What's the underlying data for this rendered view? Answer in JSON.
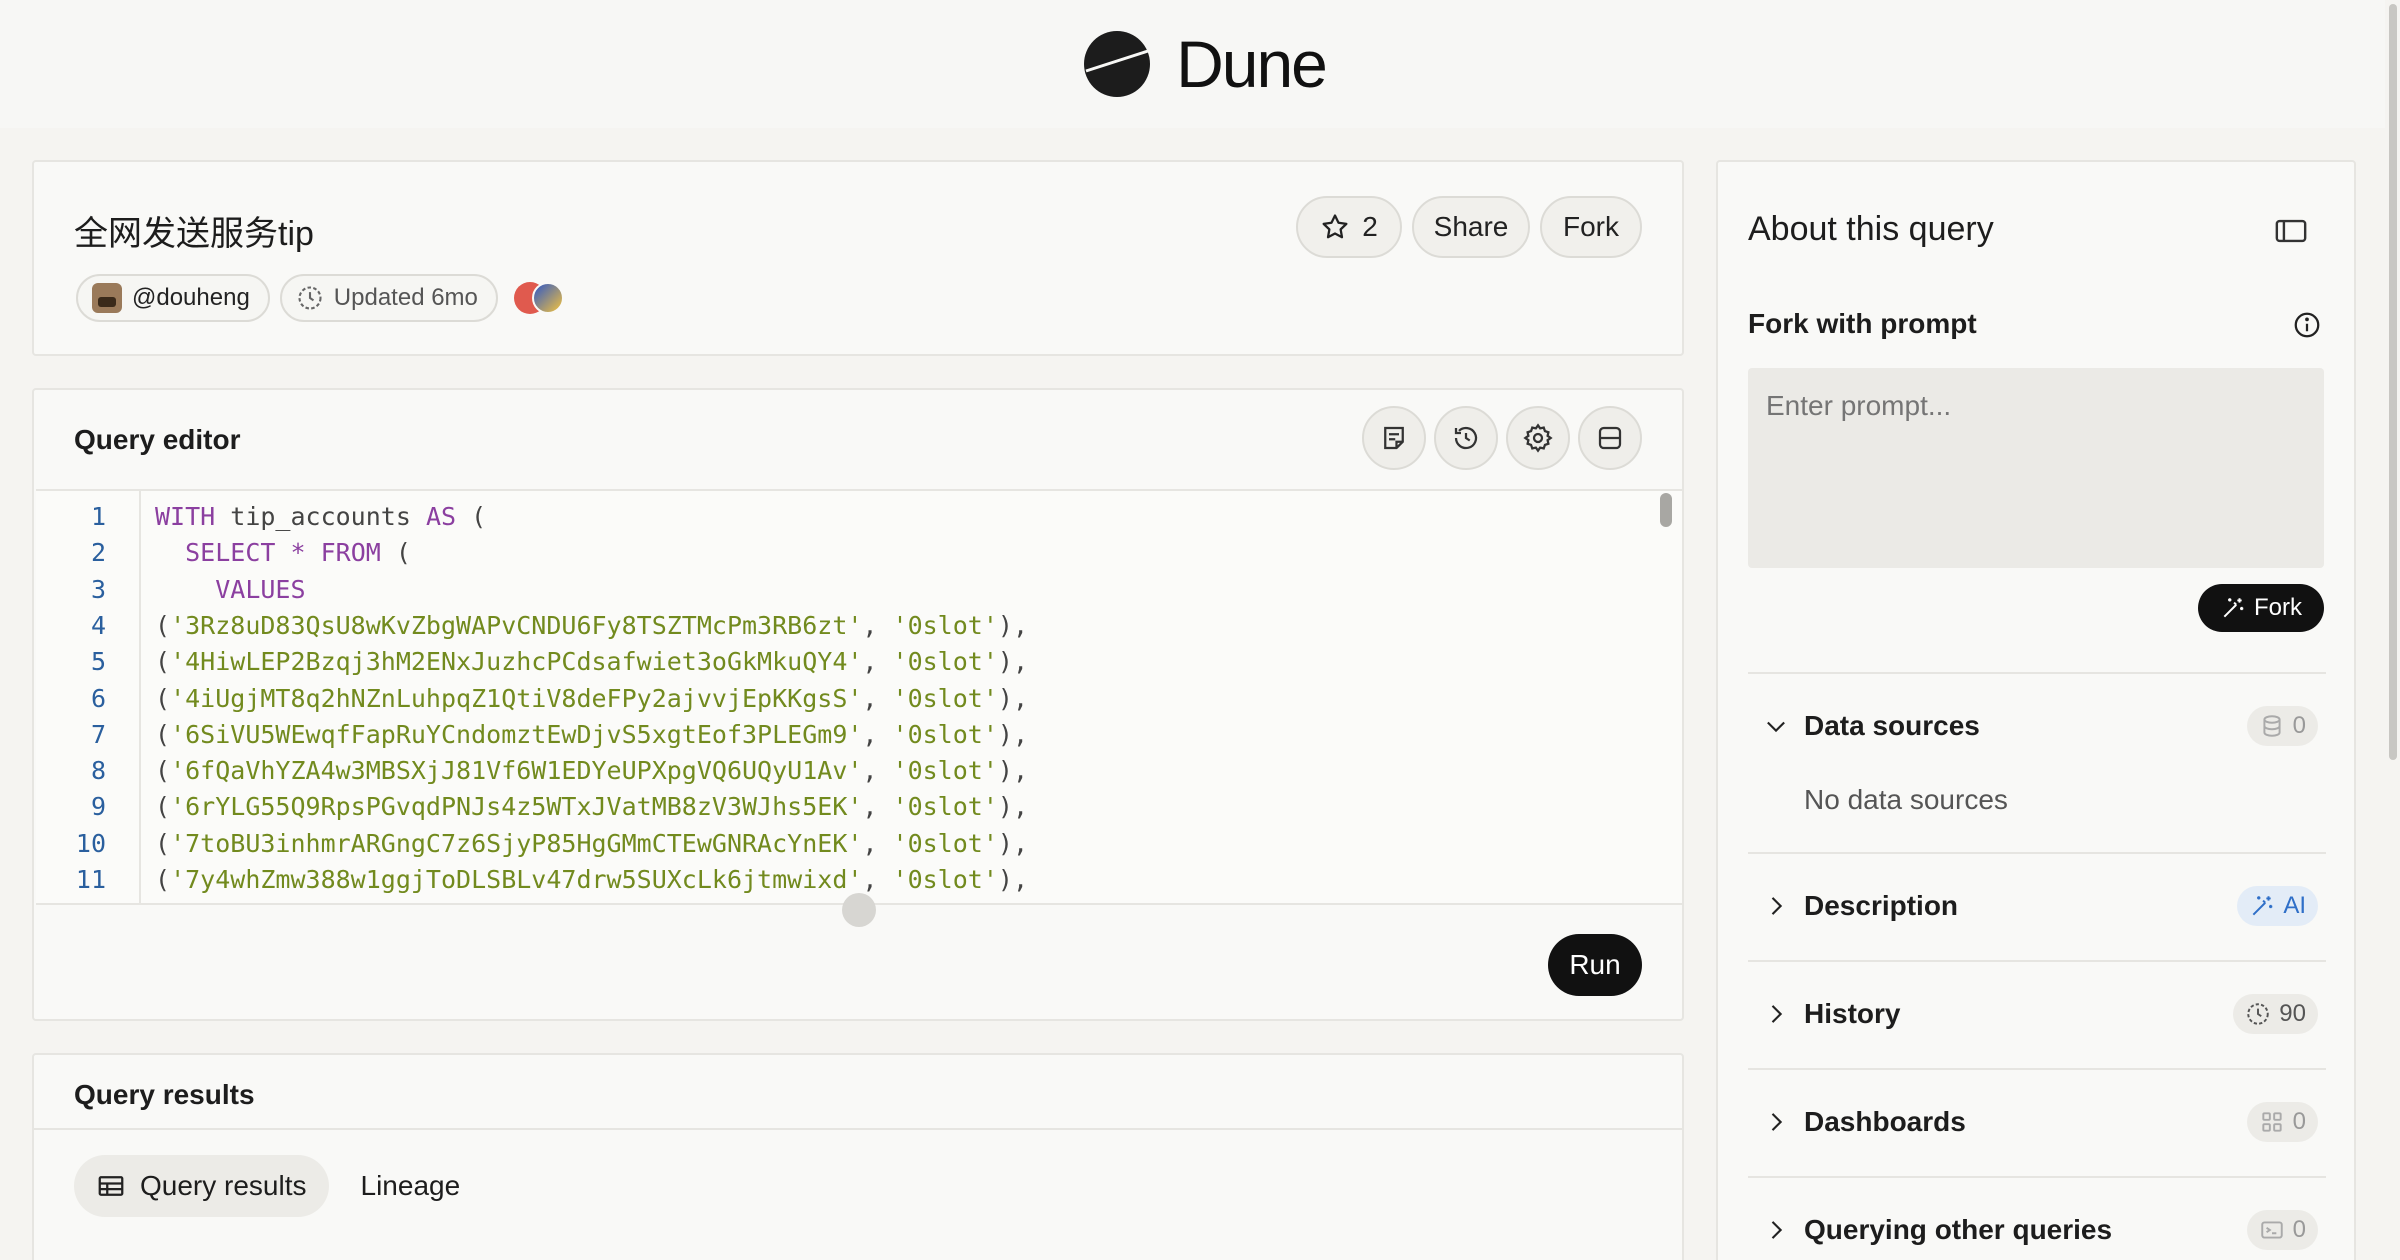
{
  "brand": {
    "name": "Dune"
  },
  "query": {
    "title": "全网发送服务tip",
    "author": "@douheng",
    "updated": "Updated 6mo",
    "stars": "2",
    "share_label": "Share",
    "fork_label": "Fork"
  },
  "editor": {
    "title": "Query editor",
    "run_label": "Run",
    "lines": [
      {
        "n": "1",
        "parts": [
          [
            "kw",
            "WITH"
          ],
          [
            "pn",
            " tip_accounts "
          ],
          [
            "kw",
            "AS"
          ],
          [
            "pn",
            " ("
          ]
        ]
      },
      {
        "n": "2",
        "parts": [
          [
            "pn",
            "  "
          ],
          [
            "kw",
            "SELECT"
          ],
          [
            "pn",
            " "
          ],
          [
            "kw",
            "*"
          ],
          [
            "pn",
            " "
          ],
          [
            "kw",
            "FROM"
          ],
          [
            "pn",
            " ("
          ]
        ]
      },
      {
        "n": "3",
        "parts": [
          [
            "pn",
            "    "
          ],
          [
            "kw",
            "VALUES"
          ]
        ]
      },
      {
        "n": "4",
        "parts": [
          [
            "pn",
            "("
          ],
          [
            "str",
            "'3Rz8uD83QsU8wKvZbgWAPvCNDU6Fy8TSZTMcPm3RB6zt'"
          ],
          [
            "pn",
            ", "
          ],
          [
            "str",
            "'0slot'"
          ],
          [
            "pn",
            "),"
          ]
        ]
      },
      {
        "n": "5",
        "parts": [
          [
            "pn",
            "("
          ],
          [
            "str",
            "'4HiwLEP2Bzqj3hM2ENxJuzhcPCdsafwiet3oGkMkuQY4'"
          ],
          [
            "pn",
            ", "
          ],
          [
            "str",
            "'0slot'"
          ],
          [
            "pn",
            "),"
          ]
        ]
      },
      {
        "n": "6",
        "parts": [
          [
            "pn",
            "("
          ],
          [
            "str",
            "'4iUgjMT8q2hNZnLuhpqZ1QtiV8deFPy2ajvvjEpKKgsS'"
          ],
          [
            "pn",
            ", "
          ],
          [
            "str",
            "'0slot'"
          ],
          [
            "pn",
            "),"
          ]
        ]
      },
      {
        "n": "7",
        "parts": [
          [
            "pn",
            "("
          ],
          [
            "str",
            "'6SiVU5WEwqfFapRuYCndomztEwDjvS5xgtEof3PLEGm9'"
          ],
          [
            "pn",
            ", "
          ],
          [
            "str",
            "'0slot'"
          ],
          [
            "pn",
            "),"
          ]
        ]
      },
      {
        "n": "8",
        "parts": [
          [
            "pn",
            "("
          ],
          [
            "str",
            "'6fQaVhYZA4w3MBSXjJ81Vf6W1EDYeUPXpgVQ6UQyU1Av'"
          ],
          [
            "pn",
            ", "
          ],
          [
            "str",
            "'0slot'"
          ],
          [
            "pn",
            "),"
          ]
        ]
      },
      {
        "n": "9",
        "parts": [
          [
            "pn",
            "("
          ],
          [
            "str",
            "'6rYLG55Q9RpsPGvqdPNJs4z5WTxJVatMB8zV3WJhs5EK'"
          ],
          [
            "pn",
            ", "
          ],
          [
            "str",
            "'0slot'"
          ],
          [
            "pn",
            "),"
          ]
        ]
      },
      {
        "n": "10",
        "parts": [
          [
            "pn",
            "("
          ],
          [
            "str",
            "'7toBU3inhmrARGngC7z6SjyP85HgGMmCTEwGNRAcYnEK'"
          ],
          [
            "pn",
            ", "
          ],
          [
            "str",
            "'0slot'"
          ],
          [
            "pn",
            "),"
          ]
        ]
      },
      {
        "n": "11",
        "parts": [
          [
            "pn",
            "("
          ],
          [
            "str",
            "'7y4whZmw388w1ggjToDLSBLv47drw5SUXcLk6jtmwixd'"
          ],
          [
            "pn",
            ", "
          ],
          [
            "str",
            "'0slot'"
          ],
          [
            "pn",
            "),"
          ]
        ]
      }
    ]
  },
  "results": {
    "title": "Query results",
    "tabs": [
      "Query results",
      "Lineage"
    ]
  },
  "sidebar": {
    "title": "About this query",
    "fork_prompt_title": "Fork with prompt",
    "prompt_placeholder": "Enter prompt...",
    "fork_label": "Fork",
    "sections": [
      {
        "label": "Data sources",
        "count": "0",
        "icon": "database-icon",
        "expanded": true,
        "empty_text": "No data sources"
      },
      {
        "label": "Description",
        "count": "AI",
        "icon": "magic-wand-icon"
      },
      {
        "label": "History",
        "count": "90",
        "icon": "history-icon"
      },
      {
        "label": "Dashboards",
        "count": "0",
        "icon": "dashboard-grid-icon"
      },
      {
        "label": "Querying other queries",
        "count": "0",
        "icon": "terminal-icon"
      }
    ]
  },
  "colors": {
    "keyword": "#8b3fa0",
    "string": "#728a1e",
    "line_number": "#2a5f9e",
    "ai_badge": "#2f6fc8"
  }
}
